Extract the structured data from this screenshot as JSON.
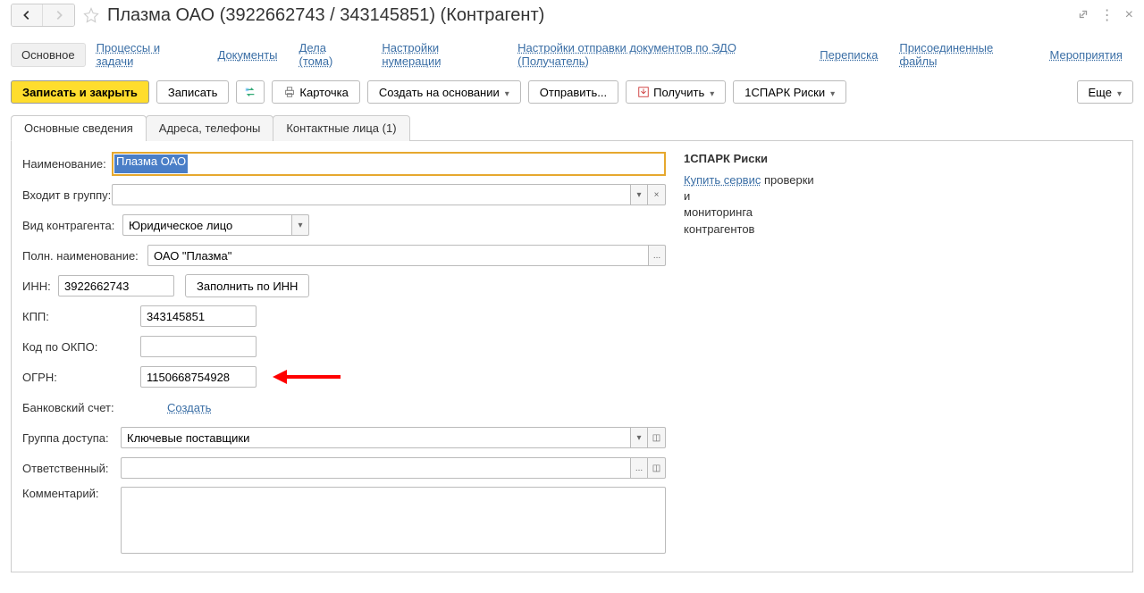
{
  "title": "Плазма ОАО (3922662743 / 343145851) (Контрагент)",
  "nav": {
    "main": "Основное",
    "processes": "Процессы и задачи",
    "documents": "Документы",
    "cases": "Дела (тома)",
    "numbering": "Настройки нумерации",
    "edo": "Настройки отправки документов по ЭДО (Получатель)",
    "correspondence": "Переписка",
    "files": "Присоединенные файлы",
    "events": "Мероприятия"
  },
  "toolbar": {
    "save_close": "Записать и закрыть",
    "save": "Записать",
    "card": "Карточка",
    "create_based": "Создать на основании",
    "send": "Отправить...",
    "receive": "Получить",
    "spark": "1СПАРК Риски",
    "more": "Еще"
  },
  "tabs": {
    "main": "Основные сведения",
    "addresses": "Адреса, телефоны",
    "contacts": "Контактные лица (1)"
  },
  "labels": {
    "name": "Наименование:",
    "group": "Входит в группу:",
    "type": "Вид контрагента:",
    "full_name": "Полн. наименование:",
    "inn": "ИНН:",
    "fill_by_inn": "Заполнить по ИНН",
    "kpp": "КПП:",
    "okpo": "Код по ОКПО:",
    "ogrn": "ОГРН:",
    "bank": "Банковский счет:",
    "create": "Создать",
    "access_group": "Группа доступа:",
    "responsible": "Ответственный:",
    "comment": "Комментарий:"
  },
  "values": {
    "name": "Плазма ОАО",
    "group": "",
    "type": "Юридическое лицо",
    "full_name": "ОАО \"Плазма\"",
    "inn": "3922662743",
    "kpp": "343145851",
    "okpo": "",
    "ogrn": "1150668754928",
    "access_group": "Ключевые поставщики",
    "responsible": "",
    "comment": ""
  },
  "spark": {
    "title": "1СПАРК Риски",
    "link": "Купить сервис",
    "text1": "проверки",
    "text2": "и",
    "text3": "мониторинга",
    "text4": "контрагентов"
  }
}
